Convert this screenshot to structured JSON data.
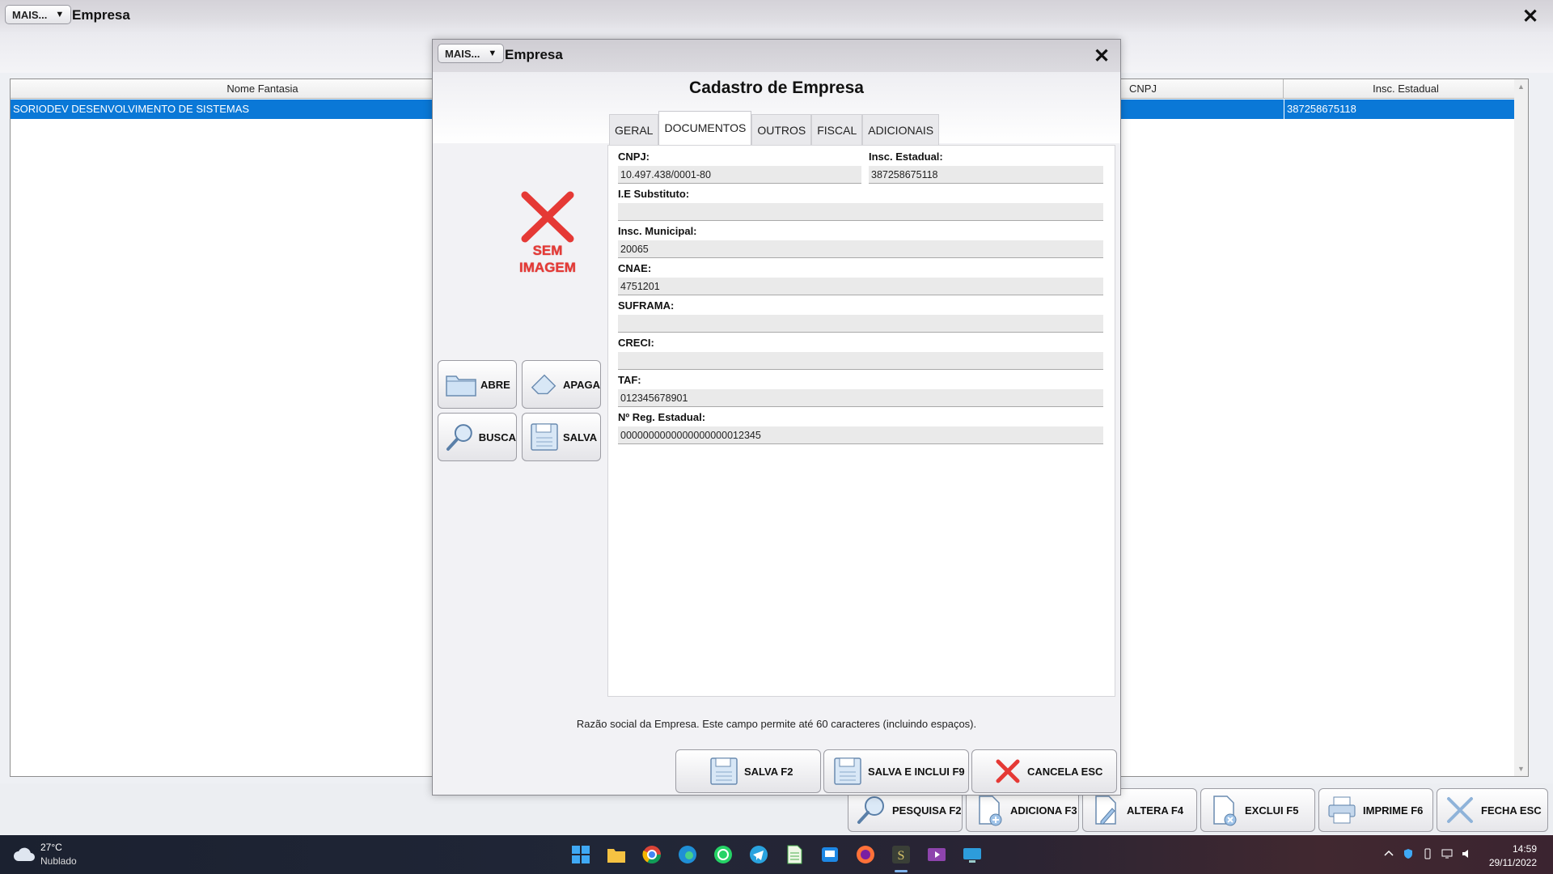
{
  "main": {
    "mais_label": "MAIS...",
    "title": "Empresa",
    "grid": {
      "columns": [
        "Nome Fantasia",
        "CNPJ",
        "Insc. Estadual"
      ],
      "rows": [
        {
          "nome_fantasia": "SORIODEV DESENVOLVIMENTO DE SISTEMAS",
          "cnpj": "",
          "insc_estadual": "387258675118"
        }
      ]
    },
    "toolbar": {
      "pesquisa": "PESQUISA F2",
      "adiciona": "ADICIONA F3",
      "altera": "ALTERA F4",
      "exclui": "EXCLUI F5",
      "imprime": "IMPRIME F6",
      "fecha": "FECHA ESC"
    }
  },
  "modal": {
    "mais_label": "MAIS...",
    "title": "Empresa",
    "heading": "Cadastro de Empresa",
    "no_image": {
      "line1": "SEM",
      "line2": "IMAGEM"
    },
    "side_buttons": {
      "abre": "ABRE",
      "apaga": "APAGA",
      "busca": "BUSCA",
      "salva": "SALVA"
    },
    "tabs": [
      "GERAL",
      "DOCUMENTOS",
      "OUTROS",
      "FISCAL",
      "ADICIONAIS"
    ],
    "active_tab": "DOCUMENTOS",
    "fields": {
      "cnpj": {
        "label": "CNPJ:",
        "value": "10.497.438/0001-80"
      },
      "insc_estadual": {
        "label": "Insc. Estadual:",
        "value": "387258675118"
      },
      "ie_substituto": {
        "label": "I.E Substituto:",
        "value": ""
      },
      "insc_municipal": {
        "label": "Insc. Municipal:",
        "value": "20065"
      },
      "cnae": {
        "label": "CNAE:",
        "value": "4751201"
      },
      "suframa": {
        "label": "SUFRAMA:",
        "value": ""
      },
      "creci": {
        "label": "CRECI:",
        "value": ""
      },
      "taf": {
        "label": "TAF:",
        "value": "012345678901"
      },
      "reg_estadual": {
        "label": "Nº Reg. Estadual:",
        "value": "0000000000000000000012345"
      }
    },
    "hint": "Razão social da Empresa. Este campo permite até 60 caracteres (incluindo espaços).",
    "footer": {
      "salva": "SALVA F2",
      "salva_inclui": "SALVA E INCLUI F9",
      "cancela": "CANCELA ESC"
    }
  },
  "taskbar": {
    "weather_temp": "27°C",
    "weather_desc": "Nublado",
    "time": "14:59",
    "date": "29/11/2022",
    "apps": [
      "start-icon",
      "file-explorer-icon",
      "chrome-icon",
      "edge-icon",
      "whatsapp-icon",
      "telegram-icon",
      "spreadsheet-icon",
      "app-icon",
      "firefox-icon",
      "soriodev-icon",
      "media-icon",
      "remote-desktop-icon"
    ]
  },
  "colors": {
    "selection": "#0a78d7",
    "no_image_red": "#e53935"
  }
}
